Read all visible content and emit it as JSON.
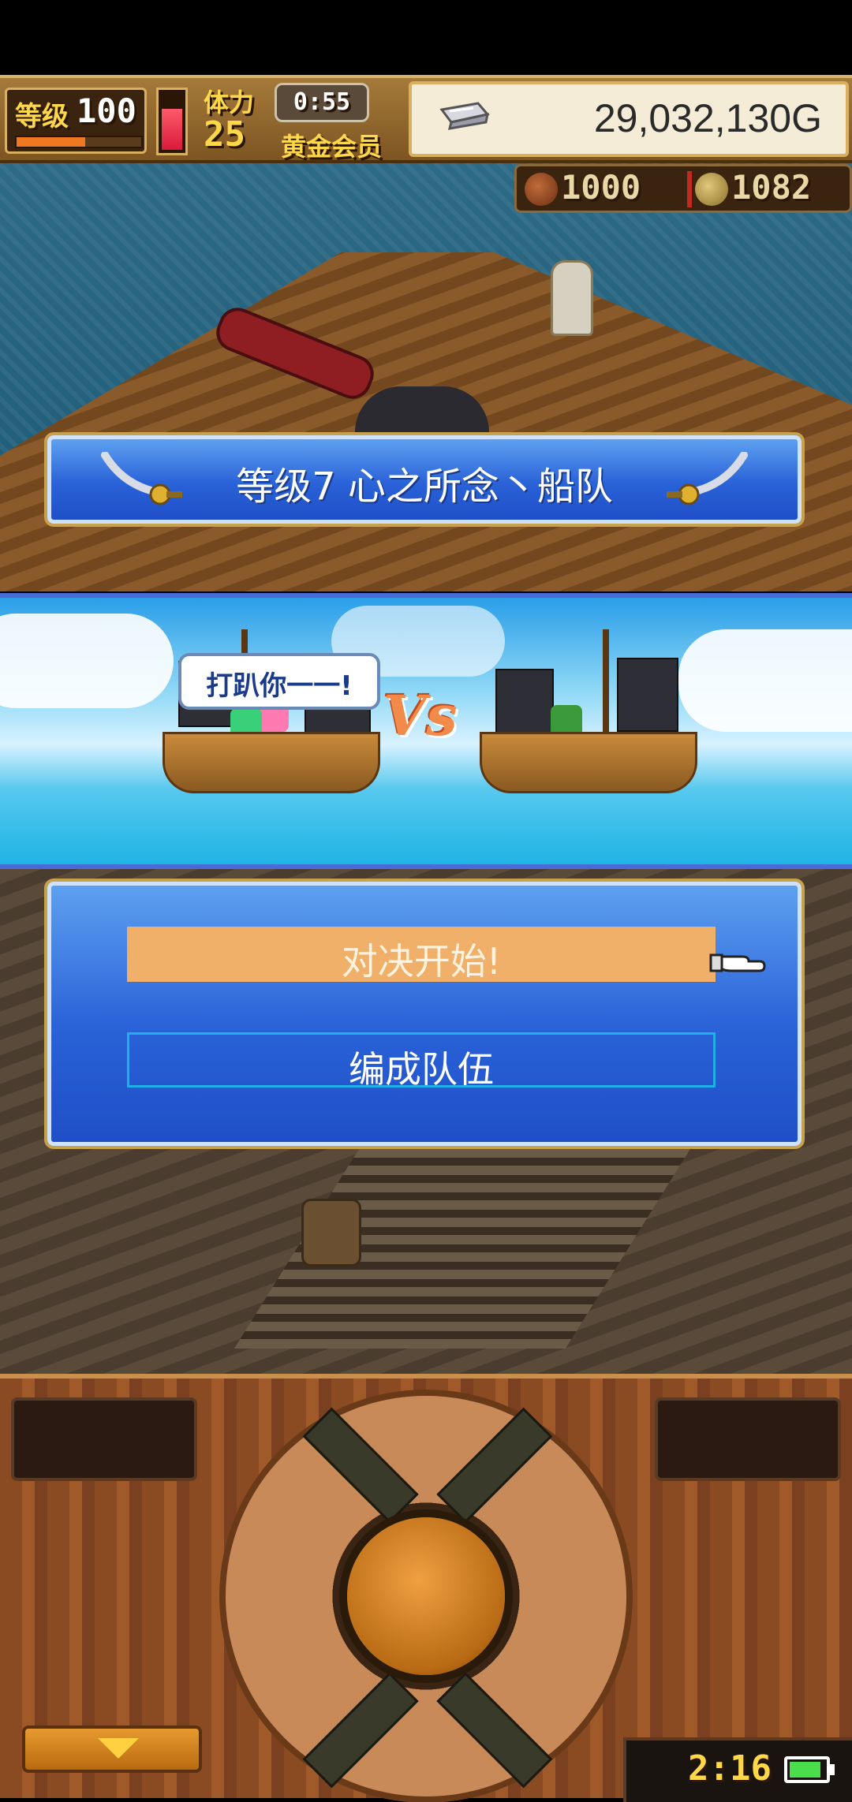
{
  "hud": {
    "level_label": "等级",
    "level_value": "100",
    "level_progress": 0.55,
    "stamina_label": "体力",
    "stamina_value": "25",
    "stamina_level": 0.7,
    "timer": "0:55",
    "member_label": "黄金会员",
    "gold": "29,032,130G"
  },
  "resources": {
    "meat": "1000",
    "coins": "1082"
  },
  "banner": {
    "title": "等级7 心之所念丶船队"
  },
  "vs": {
    "speech": "打趴你一一!",
    "vs_label": "Vs"
  },
  "menu": {
    "start_label": "对决开始!",
    "team_label": "编成队伍"
  },
  "status": {
    "clock": "2:16",
    "battery_level": 0.85
  },
  "colors": {
    "panel_blue": "#2a62d8",
    "highlight": "#f0b06a",
    "gold_text": "#ffd84a"
  },
  "icons": {
    "silver": "silver-ingot-icon",
    "meat": "meat-icon",
    "coin": "coin-icon",
    "cursor": "pointing-hand-icon",
    "sword": "cutlass-icon",
    "down": "down-arrow-icon",
    "battery": "battery-icon"
  }
}
